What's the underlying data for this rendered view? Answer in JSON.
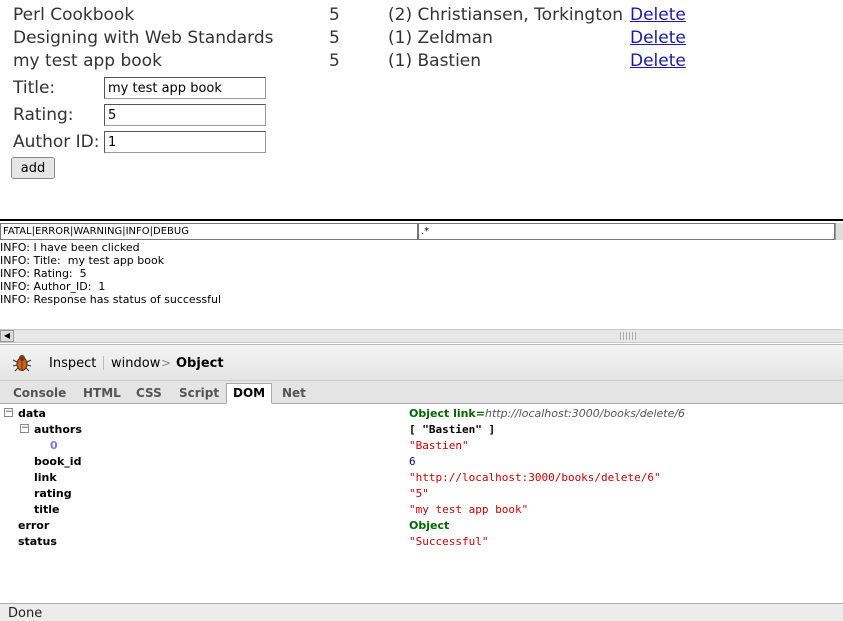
{
  "books": [
    {
      "title": "Perl Cookbook",
      "rating": "5",
      "authors": "(2) Christiansen, Torkington",
      "delete_label": "Delete"
    },
    {
      "title": "Designing with Web Standards",
      "rating": "5",
      "authors": "(1) Zeldman",
      "delete_label": "Delete"
    },
    {
      "title": "my test app book",
      "rating": "5",
      "authors": "(1) Bastien",
      "delete_label": "Delete"
    }
  ],
  "form": {
    "title_label": "Title:",
    "title_value": "my test app book",
    "rating_label": "Rating:",
    "rating_value": "5",
    "author_label": "Author ID:",
    "author_value": "1",
    "add_label": "add"
  },
  "log": {
    "level_filter": "FATAL|ERROR|WARNING|INFO|DEBUG",
    "pattern_filter": ".*",
    "lines": [
      "INFO: I have been clicked",
      "INFO: Title:  my test app book",
      "INFO: Rating:  5",
      "INFO: Author_ID:  1",
      "INFO: Response has status of successful"
    ]
  },
  "firebug": {
    "inspect_label": "Inspect",
    "breadcrumb": {
      "window": "window",
      "separator": ">",
      "object": "Object"
    },
    "tabs": [
      "Console",
      "HTML",
      "CSS",
      "Script",
      "DOM",
      "Net"
    ],
    "active_tab": "DOM",
    "dom": {
      "data_key": "data",
      "data_value": "Object link=",
      "data_link": "http://localhost:3000/books/delete/6",
      "authors_key": "authors",
      "authors_value": "[ \"Bastien\" ]",
      "author0_key": "0",
      "author0_value": "\"Bastien\"",
      "book_id_key": "book_id",
      "book_id_value": "6",
      "link_key": "link",
      "link_value": "\"http://localhost:3000/books/delete/6\"",
      "rating_key": "rating",
      "rating_value": "\"5\"",
      "title_key": "title",
      "title_value": "\"my test app book\"",
      "error_key": "error",
      "error_value": "Object",
      "status_key": "status",
      "status_value": "\"Successful\""
    }
  },
  "status_bar": {
    "text": "Done"
  },
  "colors": {
    "link": "#1a1aa6",
    "dom_object": "#006400",
    "dom_string": "#c80000",
    "dom_number": "#000088"
  }
}
